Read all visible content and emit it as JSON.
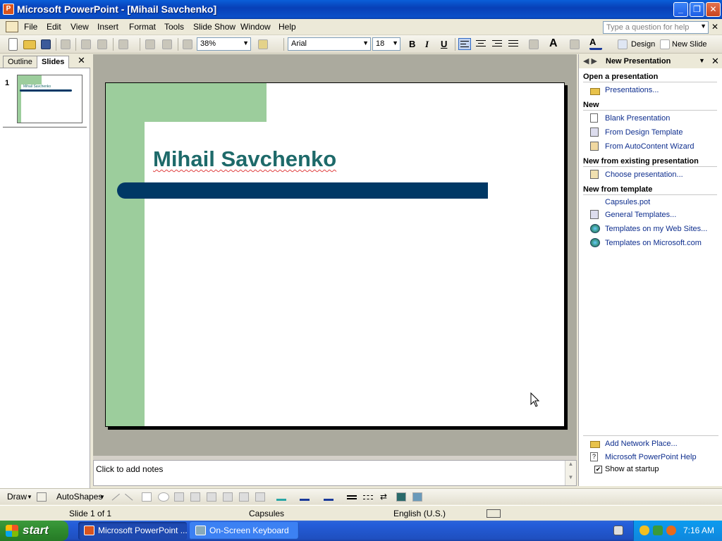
{
  "window": {
    "title": "Microsoft PowerPoint - [Mihail Savchenko]",
    "minimize_label": "_",
    "restore_label": "❐",
    "close_label": "✕"
  },
  "menu": {
    "items": [
      "File",
      "Edit",
      "View",
      "Insert",
      "Format",
      "Tools",
      "Slide Show",
      "Window",
      "Help"
    ],
    "ask_placeholder": "Type a question for help",
    "doc_close_label": "✕"
  },
  "toolbar": {
    "zoom": "38%",
    "font": "Arial",
    "font_size": "18",
    "bold_label": "B",
    "italic_label": "I",
    "underline_label": "U",
    "design_label": "Design",
    "new_slide_label": "New Slide"
  },
  "left_pane": {
    "tabs": [
      "Outline",
      "Slides"
    ],
    "active_tab": "Slides",
    "close_label": "✕",
    "slide_number": "1",
    "thumb_title": "Mihail Savchenko"
  },
  "slide": {
    "title": "Mihail Savchenko",
    "accent_color": "#9ccd9c",
    "bar_color": "#003865",
    "title_color": "#1e6a6a"
  },
  "notes": {
    "placeholder": "Click to add notes"
  },
  "task_pane": {
    "title": "New Presentation",
    "close_label": "✕",
    "sections": {
      "open": {
        "header": "Open a presentation",
        "links": [
          "Presentations..."
        ]
      },
      "new": {
        "header": "New",
        "links": [
          "Blank Presentation",
          "From Design Template",
          "From AutoContent Wizard"
        ]
      },
      "existing": {
        "header": "New from existing presentation",
        "links": [
          "Choose presentation..."
        ]
      },
      "template": {
        "header": "New from template",
        "links": [
          "Capsules.pot",
          "General Templates...",
          "Templates on my Web Sites...",
          "Templates on Microsoft.com"
        ]
      }
    },
    "bottom_links": [
      "Add Network Place...",
      "Microsoft PowerPoint Help"
    ],
    "show_at_startup": "Show at startup",
    "show_at_startup_checked": true
  },
  "draw_toolbar": {
    "draw_label": "Draw",
    "autoshapes_label": "AutoShapes"
  },
  "status": {
    "slide": "Slide 1 of 1",
    "design": "Capsules",
    "language": "English (U.S.)"
  },
  "taskbar": {
    "start_label": "start",
    "buttons": [
      {
        "label": "Microsoft PowerPoint ...",
        "active": true
      },
      {
        "label": "On-Screen Keyboard",
        "active": false
      }
    ],
    "clock": "7:16 AM"
  }
}
